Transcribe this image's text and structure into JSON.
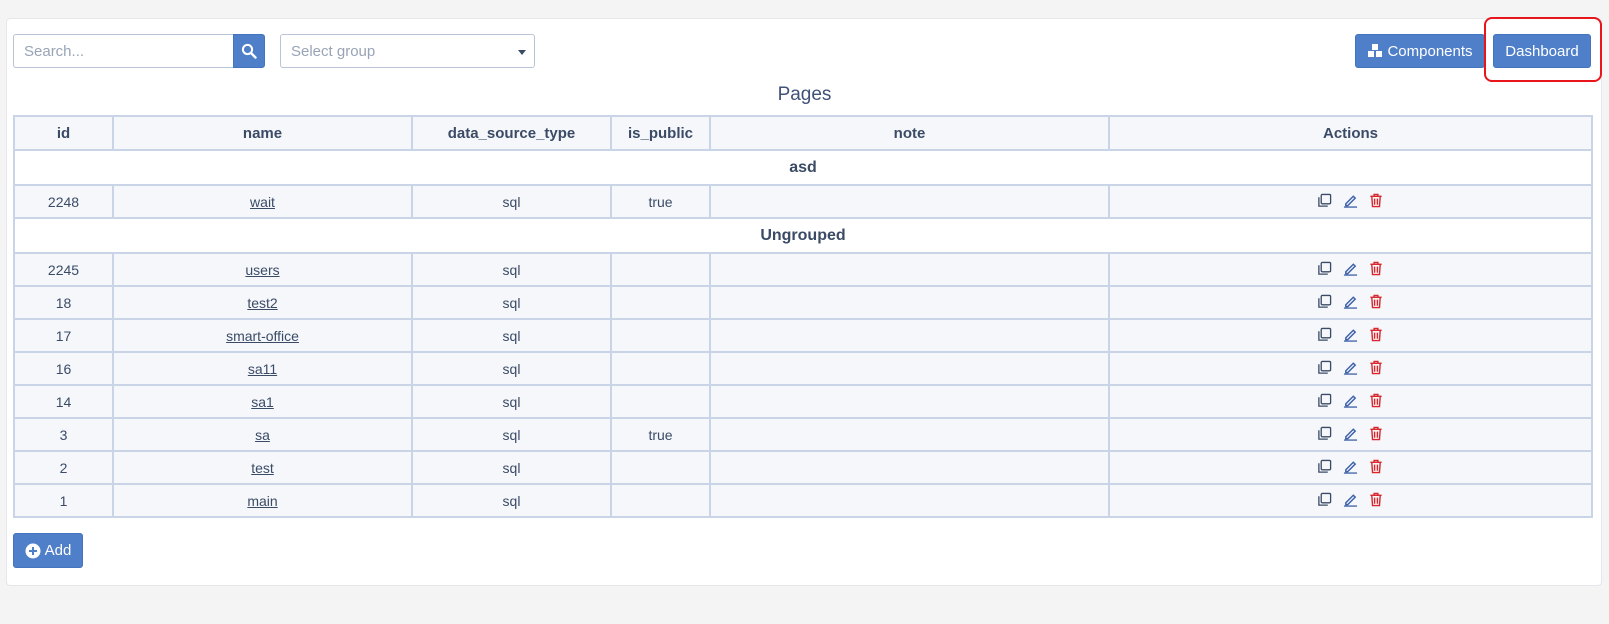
{
  "search": {
    "placeholder": "Search..."
  },
  "group_select": {
    "placeholder": "Select group"
  },
  "toolbar": {
    "components_label": "Components",
    "dashboard_label": "Dashboard",
    "add_label": "Add"
  },
  "page_title": "Pages",
  "table": {
    "columns": [
      "id",
      "name",
      "data_source_type",
      "is_public",
      "note",
      "Actions"
    ],
    "groups": [
      {
        "name": "asd",
        "rows": [
          {
            "id": "2248",
            "name": "wait",
            "data_source_type": "sql",
            "is_public": "true",
            "note": ""
          }
        ]
      },
      {
        "name": "Ungrouped",
        "rows": [
          {
            "id": "2245",
            "name": "users",
            "data_source_type": "sql",
            "is_public": "",
            "note": ""
          },
          {
            "id": "18",
            "name": "test2",
            "data_source_type": "sql",
            "is_public": "",
            "note": ""
          },
          {
            "id": "17",
            "name": "smart-office",
            "data_source_type": "sql",
            "is_public": "",
            "note": ""
          },
          {
            "id": "16",
            "name": "sa11",
            "data_source_type": "sql",
            "is_public": "",
            "note": ""
          },
          {
            "id": "14",
            "name": "sa1",
            "data_source_type": "sql",
            "is_public": "",
            "note": ""
          },
          {
            "id": "3",
            "name": "sa",
            "data_source_type": "sql",
            "is_public": "true",
            "note": ""
          },
          {
            "id": "2",
            "name": "test",
            "data_source_type": "sql",
            "is_public": "",
            "note": ""
          },
          {
            "id": "1",
            "name": "main",
            "data_source_type": "sql",
            "is_public": "",
            "note": ""
          }
        ]
      }
    ]
  },
  "colors": {
    "accent": "#4f7fc8",
    "highlight": "#e8161b",
    "delete": "#d9262b",
    "edit": "#3f63a8"
  }
}
